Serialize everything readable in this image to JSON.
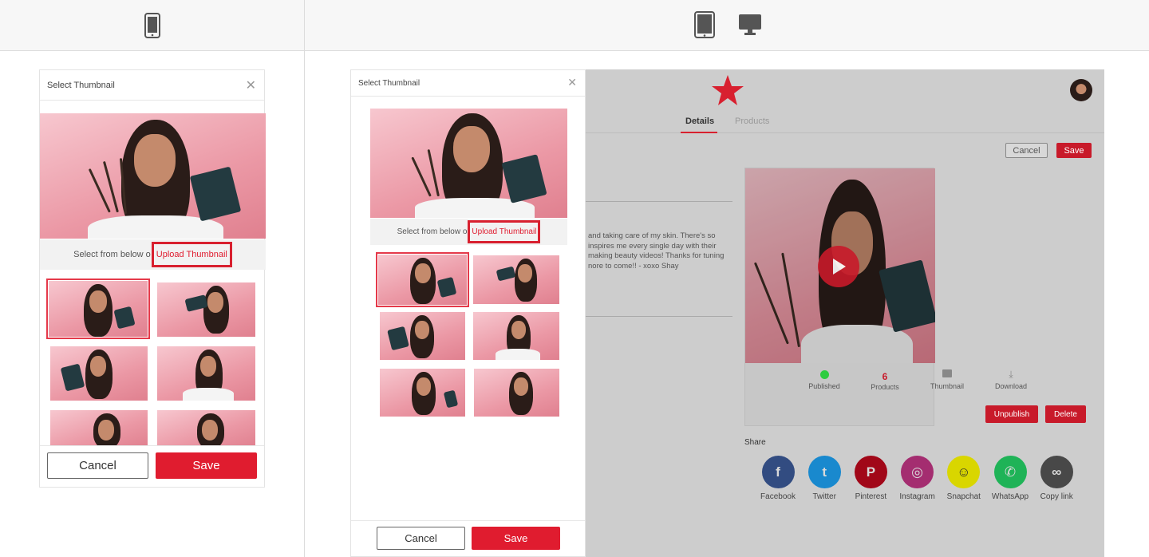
{
  "device_bar": {
    "icons": [
      "mobile-phone-icon",
      "tablet-icon",
      "desktop-monitor-icon"
    ]
  },
  "mobile_dialog": {
    "title": "Select Thumbnail",
    "caption_prefix": "Select from below o",
    "upload_link": "Upload Thumbnail",
    "cancel_label": "Cancel",
    "save_label": "Save",
    "thumbnail_count": 6,
    "selected_index": 0
  },
  "desktop_dialog": {
    "title": "Select Thumbnail",
    "caption_prefix": "Select from below o",
    "upload_link": "Upload Thumbnail",
    "cancel_label": "Cancel",
    "save_label": "Save",
    "thumbnail_count": 6,
    "selected_index": 0
  },
  "app": {
    "tabs": [
      "Details",
      "Products"
    ],
    "active_tab": "Details",
    "cancel_label": "Cancel",
    "save_label": "Save",
    "description_lines": [
      "and taking care of my skin. There's so",
      "inspires me every single day with their",
      "making beauty videos! Thanks for tuning",
      "nore to come!! - xoxo Shay"
    ],
    "stats": [
      {
        "value": "",
        "label": "Published",
        "icon": "status-dot-icon"
      },
      {
        "value": "6",
        "label": "Products",
        "icon": ""
      },
      {
        "value": "",
        "label": "Thumbnail",
        "icon": "image-icon"
      },
      {
        "value": "",
        "label": "Download",
        "icon": "download-icon"
      }
    ],
    "unpublish_label": "Unpublish",
    "delete_label": "Delete",
    "share_title": "Share",
    "share_items": [
      {
        "label": "Facebook",
        "glyph": "f",
        "color": "#3b5998"
      },
      {
        "label": "Twitter",
        "glyph": "t",
        "color": "#1da1f2"
      },
      {
        "label": "Pinterest",
        "glyph": "P",
        "color": "#bd081c"
      },
      {
        "label": "Instagram",
        "glyph": "◎",
        "color": "#c13584"
      },
      {
        "label": "Snapchat",
        "glyph": "☺",
        "color": "#fffc00"
      },
      {
        "label": "WhatsApp",
        "glyph": "✆",
        "color": "#25d366"
      },
      {
        "label": "Copy link",
        "glyph": "∞",
        "color": "#555555"
      }
    ],
    "colors": {
      "accent": "#e01c2f",
      "published": "#2ecc40"
    }
  }
}
